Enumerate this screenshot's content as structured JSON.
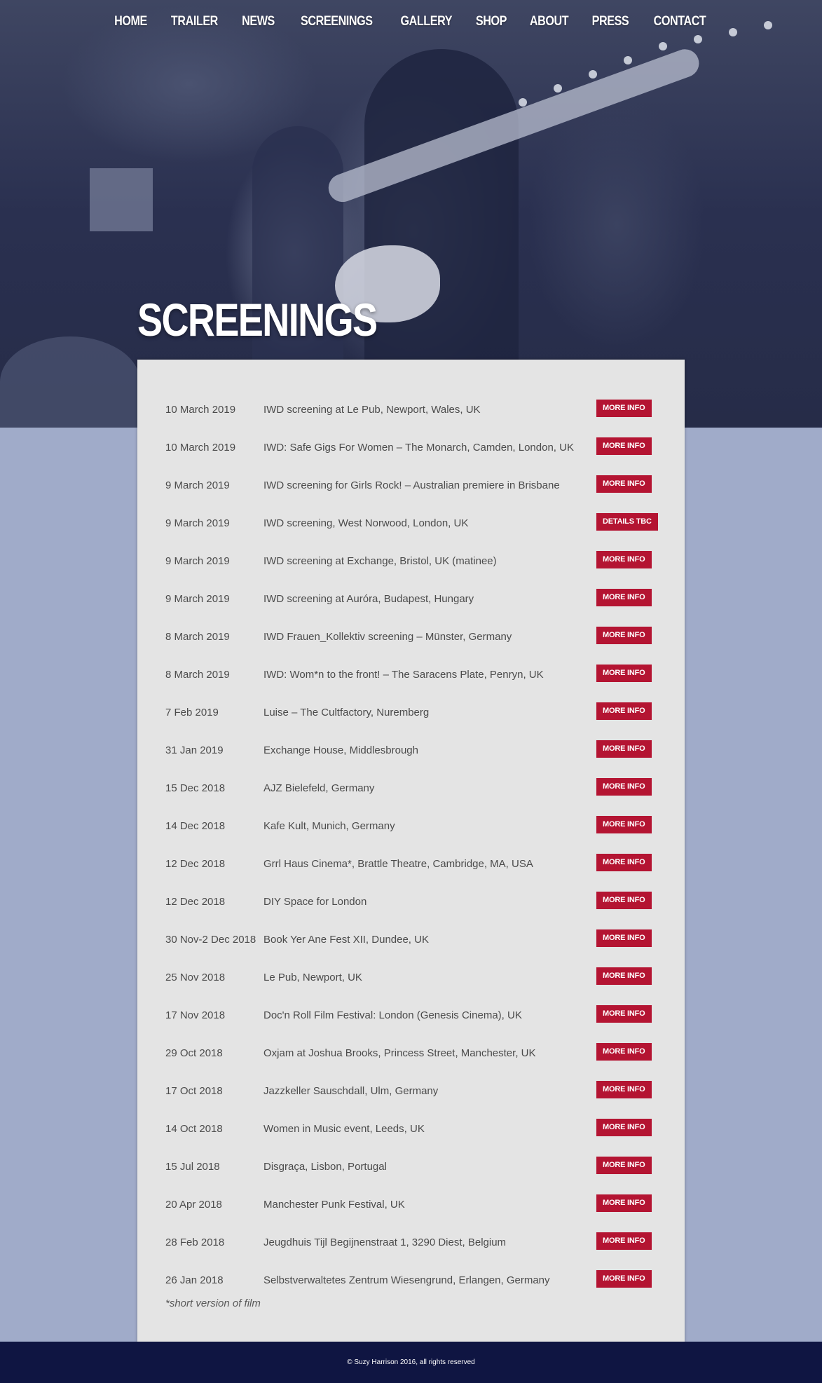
{
  "nav": [
    "HOME",
    "TRAILER",
    "NEWS",
    "SCREENINGS",
    "GALLERY",
    "SHOP",
    "ABOUT",
    "PRESS",
    "CONTACT"
  ],
  "page_title": "SCREENINGS",
  "screenings": [
    {
      "date": "10 March 2019",
      "venue": "IWD screening at Le Pub, Newport, Wales, UK",
      "action": "MORE INFO"
    },
    {
      "date": "10 March 2019",
      "venue": "IWD: Safe Gigs For Women – The Monarch, Camden, London, UK",
      "action": "MORE INFO"
    },
    {
      "date": "9 March 2019",
      "venue": "IWD screening for Girls Rock! – Australian premiere in Brisbane",
      "action": "MORE INFO"
    },
    {
      "date": "9 March 2019",
      "venue": "IWD screening, West Norwood, London, UK",
      "action": "DETAILS TBC"
    },
    {
      "date": "9 March 2019",
      "venue": "IWD screening at Exchange, Bristol, UK (matinee)",
      "action": "MORE INFO"
    },
    {
      "date": "9 March 2019",
      "venue": "IWD screening at Auróra, Budapest, Hungary",
      "action": "MORE INFO"
    },
    {
      "date": "8 March 2019",
      "venue": "IWD Frauen_Kollektiv screening – Münster, Germany",
      "action": "MORE INFO"
    },
    {
      "date": "8 March 2019",
      "venue": "IWD: Wom*n to the front! – The Saracens Plate, Penryn, UK",
      "action": "MORE INFO"
    },
    {
      "date": "7 Feb 2019",
      "venue": "Luise – The Cultfactory, Nuremberg",
      "action": "MORE INFO"
    },
    {
      "date": "31 Jan 2019",
      "venue": "Exchange House, Middlesbrough",
      "action": "MORE INFO"
    },
    {
      "date": "15 Dec 2018",
      "venue": "AJZ Bielefeld, Germany",
      "action": "MORE INFO"
    },
    {
      "date": "14 Dec 2018",
      "venue": "Kafe Kult, Munich, Germany",
      "action": "MORE INFO"
    },
    {
      "date": "12 Dec 2018",
      "venue": "Grrl Haus Cinema*, Brattle Theatre, Cambridge, MA, USA",
      "action": "MORE INFO"
    },
    {
      "date": "12 Dec 2018",
      "venue": "DIY Space for London",
      "action": "MORE INFO"
    },
    {
      "date": "30 Nov-2 Dec 2018",
      "venue": "Book Yer Ane Fest XII, Dundee, UK",
      "action": "MORE INFO"
    },
    {
      "date": "25 Nov 2018",
      "venue": "Le Pub, Newport, UK",
      "action": "MORE INFO"
    },
    {
      "date": "17 Nov 2018",
      "venue": "Doc'n Roll Film Festival: London (Genesis Cinema), UK",
      "action": "MORE INFO"
    },
    {
      "date": "29 Oct 2018",
      "venue": "Oxjam at Joshua Brooks, Princess Street, Manchester, UK",
      "action": "MORE INFO"
    },
    {
      "date": "17 Oct 2018",
      "venue": "Jazzkeller Sauschdall, Ulm, Germany",
      "action": "MORE INFO"
    },
    {
      "date": "14 Oct 2018",
      "venue": "Women in Music event, Leeds, UK",
      "action": "MORE INFO"
    },
    {
      "date": "15 Jul 2018",
      "venue": "Disgraça, Lisbon, Portugal",
      "action": "MORE INFO"
    },
    {
      "date": "20 Apr 2018",
      "venue": "Manchester Punk Festival, UK",
      "action": "MORE INFO"
    },
    {
      "date": "28 Feb 2018",
      "venue": "Jeugdhuis Tijl Begijnenstraat 1, 3290 Diest, Belgium",
      "action": "MORE INFO"
    },
    {
      "date": "26 Jan 2018",
      "venue": "Selbstverwaltetes Zentrum Wiesengrund, Erlangen, Germany",
      "action": "MORE INFO"
    }
  ],
  "note": "*short version of film",
  "footer": "© Suzy Harrison 2016, all rights reserved",
  "colors": {
    "button": "#b41432",
    "footer": "#0f1542",
    "page_bg": "#a0abc9",
    "panel": "#e4e4e4"
  }
}
